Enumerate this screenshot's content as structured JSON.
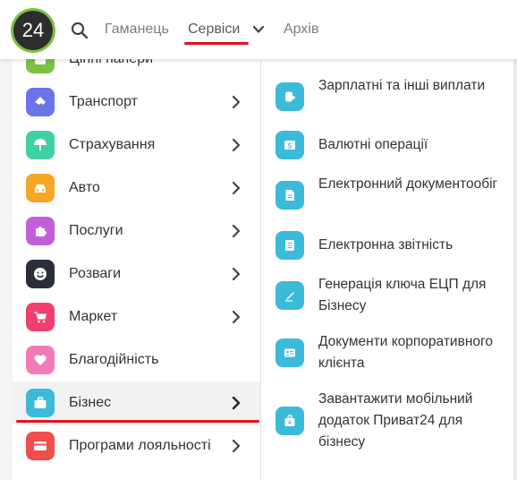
{
  "header": {
    "logo_text": "24",
    "nav": {
      "wallet": "Гаманець",
      "services": "Сервіси",
      "archive": "Архів"
    }
  },
  "categories": [
    {
      "label": "Цінні папери",
      "color": "#7cc142",
      "icon": "briefcase-icon"
    },
    {
      "label": "Транспорт",
      "color": "#6b74e8",
      "icon": "ticket-icon"
    },
    {
      "label": "Страхування",
      "color": "#3fd1a6",
      "icon": "umbrella-icon"
    },
    {
      "label": "Авто",
      "color": "#f5a623",
      "icon": "car-icon"
    },
    {
      "label": "Послуги",
      "color": "#c15fdb",
      "icon": "puzzle-icon"
    },
    {
      "label": "Розваги",
      "color": "#2a2d3a",
      "icon": "smile-icon"
    },
    {
      "label": "Маркет",
      "color": "#f0406f",
      "icon": "cart-icon"
    },
    {
      "label": "Благодійність",
      "color": "#f27bb6",
      "icon": "heart-icon"
    },
    {
      "label": "Бізнес",
      "color": "#3bbbd9",
      "icon": "briefcase-icon"
    },
    {
      "label": "Програми лояльності",
      "color": "#f24d4d",
      "icon": "card-icon"
    }
  ],
  "business_services": [
    {
      "label": "Зарплатні та інші виплати",
      "icon": "coins-icon"
    },
    {
      "label": "Валютні операції",
      "icon": "currency-icon"
    },
    {
      "label": "Електронний документообіг",
      "icon": "document-icon"
    },
    {
      "label": "Електронна звітність",
      "icon": "report-icon"
    },
    {
      "label": "Генерація ключа ЕЦП для Бізнесу",
      "icon": "signature-icon"
    },
    {
      "label": "Документи корпоративного клієнта",
      "icon": "id-card-icon"
    },
    {
      "label": "Завантажити мобільний додаток Приват24 для бізнесу",
      "icon": "download-app-icon"
    }
  ]
}
